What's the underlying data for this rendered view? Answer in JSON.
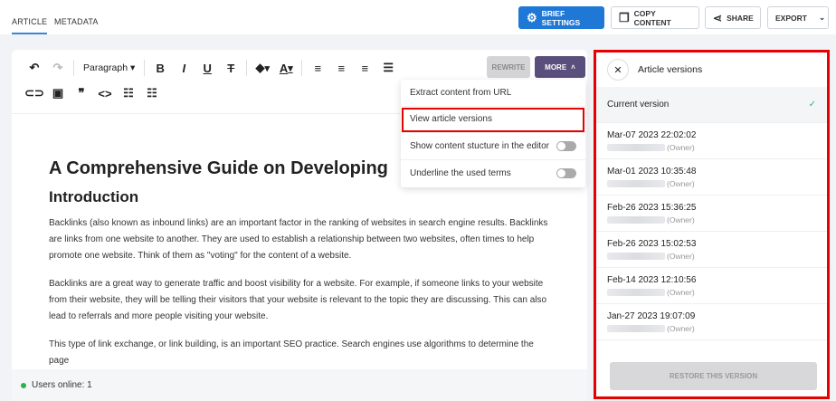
{
  "tabs": [
    {
      "label": "ARTICLE",
      "active": true
    },
    {
      "label": "METADATA",
      "active": false
    }
  ],
  "header_buttons": {
    "brief_settings": "BRIEF SETTINGS",
    "copy_content": "COPY CONTENT",
    "share": "SHARE",
    "export": "EXPORT"
  },
  "toolbar": {
    "block_format": "Paragraph",
    "rewrite": "REWRITE",
    "more": "MORE"
  },
  "more_menu": [
    "Extract content from URL",
    "View article versions",
    "Show content stucture in the editor",
    "Underline the used terms"
  ],
  "article": {
    "title": "A Comprehensive Guide on Developing",
    "heading": "Introduction",
    "paragraphs": [
      "Backlinks (also known as inbound links) are an important factor in the ranking of websites in search engine results. Backlinks are links from one website to another. They are used to establish a relationship between two websites, often times to help promote one website. Think of them as \"voting\" for the content of a website.",
      "Backlinks are a great way to generate traffic and boost visibility for a website. For example, if someone links to your website from their website, they will be telling their visitors that your website is relevant to the topic they are discussing. This can also lead to referrals and more people visiting your website.",
      "This type of link exchange, or link building, is an important SEO practice. Search engines use algorithms to determine the page"
    ]
  },
  "footer": {
    "users_online": "Users online: 1"
  },
  "versions_panel": {
    "title": "Article versions",
    "current": "Current version",
    "versions": [
      {
        "date": "Mar-07 2023 22:02:02",
        "role": "(Owner)"
      },
      {
        "date": "Mar-01 2023 10:35:48",
        "role": "(Owner)"
      },
      {
        "date": "Feb-26 2023 15:36:25",
        "role": "(Owner)"
      },
      {
        "date": "Feb-26 2023 15:02:53",
        "role": "(Owner)"
      },
      {
        "date": "Feb-14 2023 12:10:56",
        "role": "(Owner)"
      },
      {
        "date": "Jan-27 2023 19:07:09",
        "role": "(Owner)"
      }
    ],
    "restore": "RESTORE THIS VERSION"
  }
}
